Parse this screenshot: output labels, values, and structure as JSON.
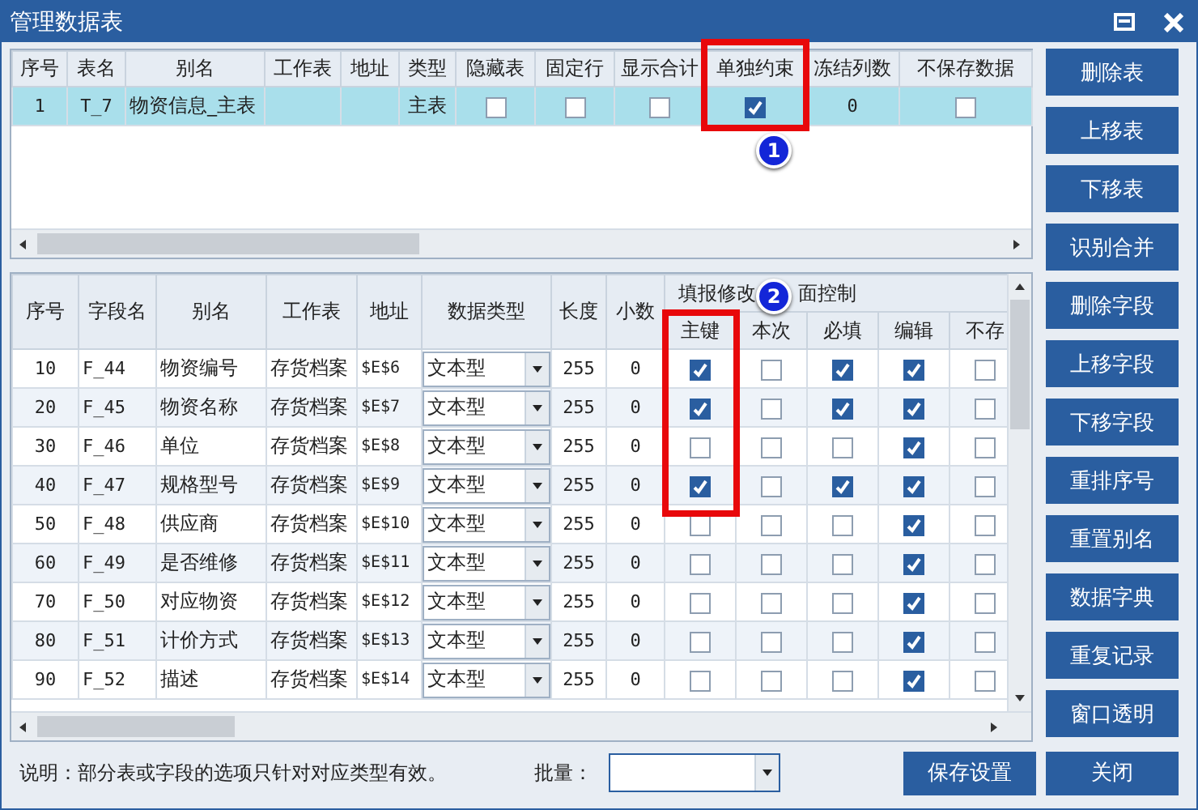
{
  "window": {
    "title": "管理数据表"
  },
  "tables_grid": {
    "columns": [
      "序号",
      "表名",
      "别名",
      "工作表",
      "地址",
      "类型",
      "隐藏表",
      "固定行",
      "显示合计",
      "单独约束",
      "冻结列数",
      "不保存数据"
    ],
    "rows": [
      {
        "selected": true,
        "cells": [
          {
            "kind": "text",
            "text": "1"
          },
          {
            "kind": "text",
            "text": "T_7"
          },
          {
            "kind": "text",
            "text": "物资信息_主表"
          },
          {
            "kind": "blank"
          },
          {
            "kind": "blank"
          },
          {
            "kind": "text",
            "text": "主表"
          },
          {
            "kind": "check",
            "checked": false
          },
          {
            "kind": "check",
            "checked": false
          },
          {
            "kind": "check",
            "checked": false
          },
          {
            "kind": "check",
            "checked": true
          },
          {
            "kind": "text",
            "text": "0"
          },
          {
            "kind": "check",
            "checked": false
          }
        ]
      }
    ]
  },
  "fields_grid": {
    "columns": [
      "序号",
      "字段名",
      "别名",
      "工作表",
      "地址",
      "数据类型",
      "长度",
      "小数"
    ],
    "group_header": [
      "填报修改",
      "面控制"
    ],
    "check_columns": [
      "主键",
      "本次",
      "必填",
      "编辑",
      "不存"
    ],
    "rows": [
      {
        "seq": "10",
        "field": "F_44",
        "alias": "物资编号",
        "sheet": "存货档案",
        "address": "$E$6",
        "type": "文本型",
        "length": "255",
        "decimals": "0",
        "checks": [
          true,
          false,
          true,
          true,
          false
        ]
      },
      {
        "seq": "20",
        "field": "F_45",
        "alias": "物资名称",
        "sheet": "存货档案",
        "address": "$E$7",
        "type": "文本型",
        "length": "255",
        "decimals": "0",
        "checks": [
          true,
          false,
          true,
          true,
          false
        ]
      },
      {
        "seq": "30",
        "field": "F_46",
        "alias": "单位",
        "sheet": "存货档案",
        "address": "$E$8",
        "type": "文本型",
        "length": "255",
        "decimals": "0",
        "checks": [
          false,
          false,
          false,
          true,
          false
        ]
      },
      {
        "seq": "40",
        "field": "F_47",
        "alias": "规格型号",
        "sheet": "存货档案",
        "address": "$E$9",
        "type": "文本型",
        "length": "255",
        "decimals": "0",
        "checks": [
          true,
          false,
          true,
          true,
          false
        ]
      },
      {
        "seq": "50",
        "field": "F_48",
        "alias": "供应商",
        "sheet": "存货档案",
        "address": "$E$10",
        "type": "文本型",
        "length": "255",
        "decimals": "0",
        "checks": [
          false,
          false,
          false,
          true,
          false
        ]
      },
      {
        "seq": "60",
        "field": "F_49",
        "alias": "是否维修",
        "sheet": "存货档案",
        "address": "$E$11",
        "type": "文本型",
        "length": "255",
        "decimals": "0",
        "checks": [
          false,
          false,
          false,
          true,
          false
        ]
      },
      {
        "seq": "70",
        "field": "F_50",
        "alias": "对应物资",
        "sheet": "存货档案",
        "address": "$E$12",
        "type": "文本型",
        "length": "255",
        "decimals": "0",
        "checks": [
          false,
          false,
          false,
          true,
          false
        ]
      },
      {
        "seq": "80",
        "field": "F_51",
        "alias": "计价方式",
        "sheet": "存货档案",
        "address": "$E$13",
        "type": "文本型",
        "length": "255",
        "decimals": "0",
        "checks": [
          false,
          false,
          false,
          true,
          false
        ]
      },
      {
        "seq": "90",
        "field": "F_52",
        "alias": "描述",
        "sheet": "存货档案",
        "address": "$E$14",
        "type": "文本型",
        "length": "255",
        "decimals": "0",
        "checks": [
          false,
          false,
          false,
          true,
          false
        ]
      }
    ]
  },
  "side_buttons": [
    "删除表",
    "上移表",
    "下移表",
    "识别合并",
    "删除字段",
    "上移字段",
    "下移字段",
    "重排序号",
    "重置别名",
    "数据字典",
    "重复记录",
    "窗口透明"
  ],
  "footer": {
    "note": "说明：部分表或字段的选项只针对对应类型有效。",
    "batch_label": "批量：",
    "save_button": "保存设置",
    "close_button": "关闭"
  },
  "annotations": [
    {
      "number": "1"
    },
    {
      "number": "2"
    }
  ]
}
